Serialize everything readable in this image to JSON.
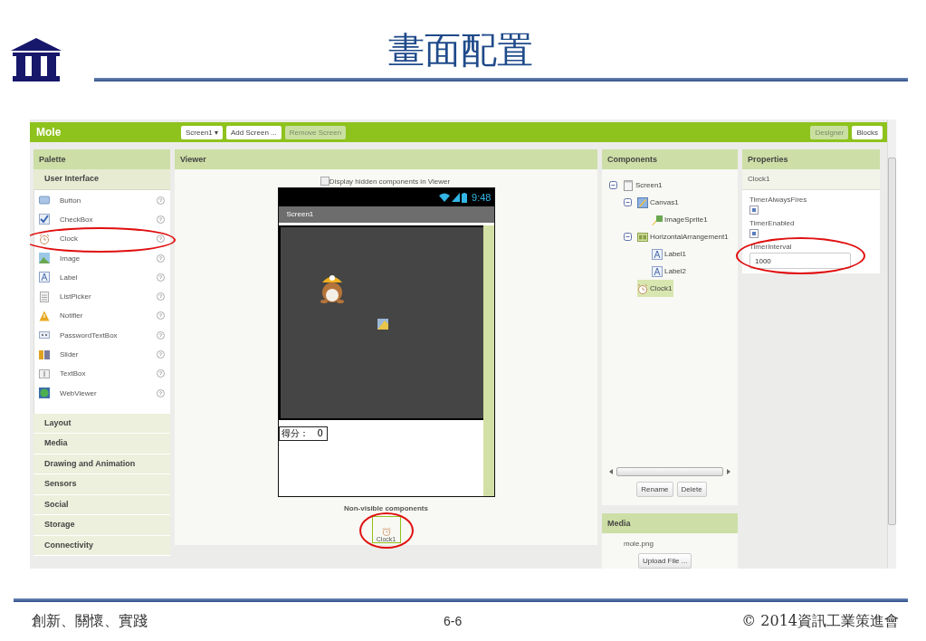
{
  "slide": {
    "title": "畫面配置",
    "footer_left": "創新、關懷、實踐",
    "page": "6-6",
    "footer_right": "© 2014資訊工業策進會"
  },
  "app": {
    "project": "Mole",
    "screen_buttons": [
      {
        "label": "Screen1 ▾",
        "disabled": false
      },
      {
        "label": "Add Screen ...",
        "disabled": false
      },
      {
        "label": "Remove Screen",
        "disabled": true
      }
    ],
    "mode_buttons": [
      {
        "label": "Designer",
        "selected": true
      },
      {
        "label": "Blocks",
        "selected": false
      }
    ]
  },
  "palette": {
    "title": "Palette",
    "sections": [
      {
        "label": "User Interface",
        "expanded": true,
        "items": [
          {
            "label": "Button",
            "kind": "button",
            "annotated": false
          },
          {
            "label": "CheckBox",
            "kind": "checkbox",
            "annotated": false
          },
          {
            "label": "Clock",
            "kind": "clock",
            "annotated": true
          },
          {
            "label": "Image",
            "kind": "image",
            "annotated": false
          },
          {
            "label": "Label",
            "kind": "label",
            "annotated": false
          },
          {
            "label": "ListPicker",
            "kind": "listpicker",
            "annotated": false
          },
          {
            "label": "Notifier",
            "kind": "notifier",
            "annotated": false
          },
          {
            "label": "PasswordTextBox",
            "kind": "password",
            "annotated": false
          },
          {
            "label": "Slider",
            "kind": "slider",
            "annotated": false
          },
          {
            "label": "TextBox",
            "kind": "textbox",
            "annotated": false
          },
          {
            "label": "WebViewer",
            "kind": "webviewer",
            "annotated": false
          }
        ]
      },
      {
        "label": "Layout",
        "expanded": false
      },
      {
        "label": "Media",
        "expanded": false
      },
      {
        "label": "Drawing and Animation",
        "expanded": false
      },
      {
        "label": "Sensors",
        "expanded": false
      },
      {
        "label": "Social",
        "expanded": false
      },
      {
        "label": "Storage",
        "expanded": false
      },
      {
        "label": "Connectivity",
        "expanded": false
      }
    ]
  },
  "viewer": {
    "title": "Viewer",
    "hidden_checkbox": {
      "label": "Display hidden components in Viewer",
      "checked": false
    },
    "phone": {
      "time": "9:48",
      "screen_title": "Screen1",
      "score_label": "得分：",
      "score": "0"
    },
    "nonvisible_title": "Non-visible components",
    "nonvisible": [
      {
        "label": "Clock1",
        "annotated": true
      }
    ]
  },
  "components": {
    "title": "Components",
    "tree": [
      {
        "label": "Screen1",
        "kind": "screen",
        "expanded": true,
        "selected": false,
        "children": [
          {
            "label": "Canvas1",
            "kind": "canvas",
            "expanded": true,
            "selected": false,
            "children": [
              {
                "label": "ImageSprite1",
                "kind": "sprite",
                "selected": false
              }
            ]
          },
          {
            "label": "HorizontalArrangement1",
            "kind": "arrangement",
            "expanded": true,
            "selected": false,
            "children": [
              {
                "label": "Label1",
                "kind": "label",
                "selected": false
              },
              {
                "label": "Label2",
                "kind": "label",
                "selected": false
              }
            ]
          },
          {
            "label": "Clock1",
            "kind": "clock",
            "selected": true
          }
        ]
      }
    ],
    "buttons": [
      "Rename",
      "Delete"
    ]
  },
  "properties": {
    "title": "Properties",
    "component": "Clock1",
    "items": [
      {
        "label": "TimerAlwaysFires",
        "kind": "checkbox",
        "checked": true,
        "annotated": false
      },
      {
        "label": "TimerEnabled",
        "kind": "checkbox",
        "checked": true,
        "annotated": false
      },
      {
        "label": "TimerInterval",
        "kind": "text",
        "value": "1000",
        "annotated": true
      }
    ]
  },
  "media": {
    "title": "Media",
    "files": [
      "mole.png"
    ],
    "upload_button": "Upload File ..."
  }
}
